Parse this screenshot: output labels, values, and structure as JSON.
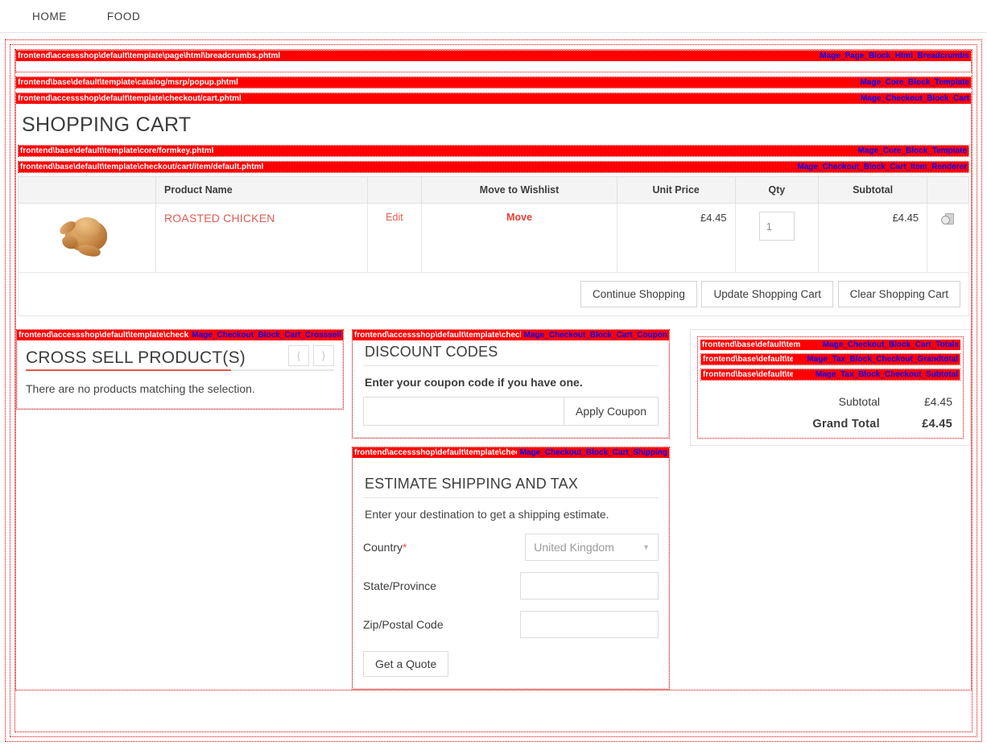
{
  "nav": {
    "items": [
      {
        "label": "HOME"
      },
      {
        "label": "FOOD"
      }
    ]
  },
  "hints": {
    "breadcrumbs": {
      "path": "frontend\\accessshop\\default\\template\\page\\html\\breadcrumbs.phtml",
      "block": "Mage_Page_Block_Html_Breadcrumbs"
    },
    "msrp_popup": {
      "path": "frontend\\base\\default\\template\\catalog/msrp/popup.phtml",
      "block": "Mage_Core_Block_Template"
    },
    "cart": {
      "path": "frontend\\accessshop\\default\\template\\checkout/cart.phtml",
      "block": "Mage_Checkout_Block_Cart"
    },
    "formkey": {
      "path": "frontend\\base\\default\\template\\core/formkey.phtml",
      "block": "Mage_Core_Block_Template"
    },
    "cart_item": {
      "path": "frontend\\base\\default\\template\\checkout/cart/item/default.phtml",
      "block": "Mage_Checkout_Block_Cart_Item_Renderer"
    },
    "crosssell": {
      "path": "frontend\\accessshop\\default\\template\\checkout/cart/crosssell.phtml",
      "block": "Mage_Checkout_Block_Cart_Crosssell"
    },
    "coupon": {
      "path": "frontend\\accessshop\\default\\template\\checkout/cart/coupon.phtml",
      "block": "Mage_Checkout_Block_Cart_Coupon"
    },
    "shipping": {
      "path": "frontend\\accessshop\\default\\template\\checkout/cart/shipping.phtml",
      "block": "Mage_Checkout_Block_Cart_Shipping"
    },
    "totals": {
      "path": "frontend\\base\\default\\template\\checkout/cart/totals.phtml",
      "block": "Mage_Checkout_Block_Cart_Totals"
    },
    "grandtotal": {
      "path": "frontend\\base\\default\\template\\tax/checkout/grandtotal.phtml",
      "block": "Mage_Tax_Block_Checkout_Grandtotal"
    },
    "subtotal": {
      "path": "frontend\\base\\default\\template\\tax/checkout/subtotal.phtml",
      "block": "Mage_Tax_Block_Checkout_Subtotal"
    }
  },
  "page": {
    "title": "SHOPPING CART"
  },
  "cart_table": {
    "headers": [
      "",
      "Product Name",
      "",
      "Move to Wishlist",
      "Unit Price",
      "Qty",
      "Subtotal",
      ""
    ],
    "rows": [
      {
        "image_icon": "roasted-chicken-photo",
        "name": "ROASTED CHICKEN",
        "edit_label": "Edit",
        "move_label": "Move",
        "unit_price": "£4.45",
        "qty": "1",
        "subtotal": "£4.45",
        "remove_icon": "trash-icon"
      }
    ],
    "buttons": [
      {
        "label": "Continue Shopping"
      },
      {
        "label": "Update Shopping Cart"
      },
      {
        "label": "Clear Shopping Cart"
      }
    ]
  },
  "crosssell": {
    "title": "CROSS SELL PRODUCT(S)",
    "prev_icon": "chevron-left-icon",
    "next_icon": "chevron-right-icon",
    "empty_message": "There are no products matching the selection."
  },
  "discount": {
    "title": "DISCOUNT CODES",
    "lead": "Enter your coupon code if you have one.",
    "input_value": "",
    "input_placeholder": "",
    "apply_label": "Apply Coupon"
  },
  "shipping": {
    "title": "ESTIMATE SHIPPING AND TAX",
    "lead": "Enter your destination to get a shipping estimate.",
    "country_label": "Country",
    "country_required": "*",
    "country_value": "United Kingdom",
    "country_caret": "chevron-down-icon",
    "state_label": "State/Province",
    "state_value": "",
    "zip_label": "Zip/Postal Code",
    "zip_value": "",
    "quote_label": "Get a Quote"
  },
  "totals": {
    "rows": [
      {
        "label": "Subtotal",
        "value": "£4.45"
      },
      {
        "label": "Grand Total",
        "value": "£4.45"
      }
    ]
  },
  "colors": {
    "hint_bar": "#ff0000",
    "hint_block_text": "#0000ff",
    "accent": "#e8564a",
    "link": "#e05c52"
  }
}
